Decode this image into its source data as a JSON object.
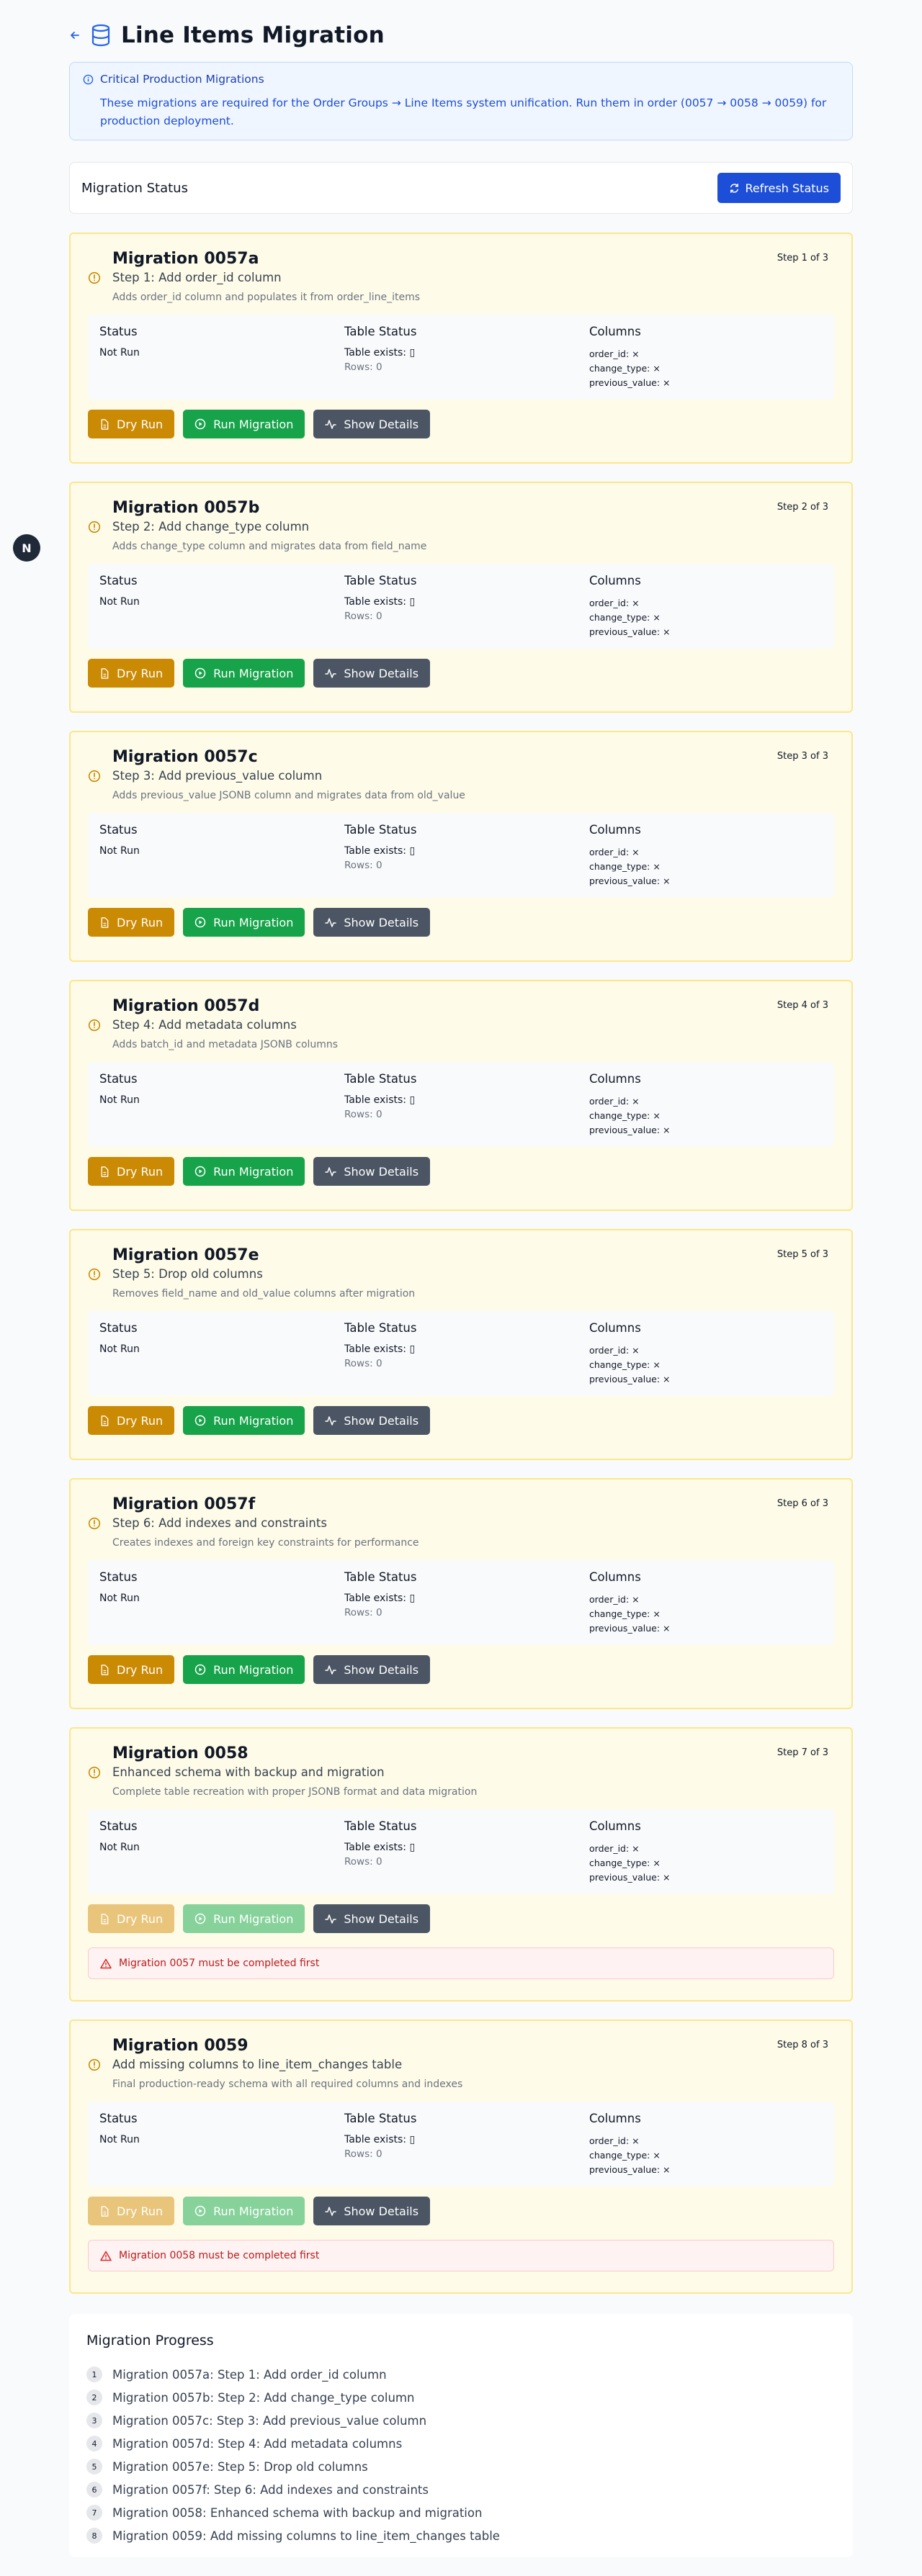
{
  "header": {
    "title": "Line Items Migration"
  },
  "info": {
    "title": "Critical Production Migrations",
    "text": "These migrations are required for the Order Groups → Line Items system unification. Run them in order (0057 → 0058 → 0059) for production deployment."
  },
  "status_bar": {
    "title": "Migration Status",
    "refresh_label": "Refresh Status"
  },
  "labels": {
    "status": "Status",
    "table_status": "Table Status",
    "columns": "Columns",
    "dry_run": "Dry Run",
    "run_migration": "Run Migration",
    "show_details": "Show Details"
  },
  "migrations": [
    {
      "title": "Migration 0057a",
      "subtitle": "Step 1: Add order_id column",
      "description": "Adds order_id column and populates it from order_line_items",
      "step": "Step 1 of 3",
      "status": "Not Run",
      "table_exists": "Table exists: ▯",
      "rows": "Rows: 0",
      "col1": "order_id: ×",
      "col2": "change_type: ×",
      "col3": "previous_value: ×"
    },
    {
      "title": "Migration 0057b",
      "subtitle": "Step 2: Add change_type column",
      "description": "Adds change_type column and migrates data from field_name",
      "step": "Step 2 of 3",
      "status": "Not Run",
      "table_exists": "Table exists: ▯",
      "rows": "Rows: 0",
      "col1": "order_id: ×",
      "col2": "change_type: ×",
      "col3": "previous_value: ×"
    },
    {
      "title": "Migration 0057c",
      "subtitle": "Step 3: Add previous_value column",
      "description": "Adds previous_value JSONB column and migrates data from old_value",
      "step": "Step 3 of 3",
      "status": "Not Run",
      "table_exists": "Table exists: ▯",
      "rows": "Rows: 0",
      "col1": "order_id: ×",
      "col2": "change_type: ×",
      "col3": "previous_value: ×"
    },
    {
      "title": "Migration 0057d",
      "subtitle": "Step 4: Add metadata columns",
      "description": "Adds batch_id and metadata JSONB columns",
      "step": "Step 4 of 3",
      "status": "Not Run",
      "table_exists": "Table exists: ▯",
      "rows": "Rows: 0",
      "col1": "order_id: ×",
      "col2": "change_type: ×",
      "col3": "previous_value: ×"
    },
    {
      "title": "Migration 0057e",
      "subtitle": "Step 5: Drop old columns",
      "description": "Removes field_name and old_value columns after migration",
      "step": "Step 5 of 3",
      "status": "Not Run",
      "table_exists": "Table exists: ▯",
      "rows": "Rows: 0",
      "col1": "order_id: ×",
      "col2": "change_type: ×",
      "col3": "previous_value: ×"
    },
    {
      "title": "Migration 0057f",
      "subtitle": "Step 6: Add indexes and constraints",
      "description": "Creates indexes and foreign key constraints for performance",
      "step": "Step 6 of 3",
      "status": "Not Run",
      "table_exists": "Table exists: ▯",
      "rows": "Rows: 0",
      "col1": "order_id: ×",
      "col2": "change_type: ×",
      "col3": "previous_value: ×"
    },
    {
      "title": "Migration 0058",
      "subtitle": "Enhanced schema with backup and migration",
      "description": "Complete table recreation with proper JSONB format and data migration",
      "step": "Step 7 of 3",
      "status": "Not Run",
      "table_exists": "Table exists: ▯",
      "rows": "Rows: 0",
      "col1": "order_id: ×",
      "col2": "change_type: ×",
      "col3": "previous_value: ×",
      "alert": "Migration 0057 must be completed first"
    },
    {
      "title": "Migration 0059",
      "subtitle": "Add missing columns to line_item_changes table",
      "description": "Final production-ready schema with all required columns and indexes",
      "step": "Step 8 of 3",
      "status": "Not Run",
      "table_exists": "Table exists: ▯",
      "rows": "Rows: 0",
      "col1": "order_id: ×",
      "col2": "change_type: ×",
      "col3": "previous_value: ×",
      "alert": "Migration 0058 must be completed first"
    }
  ],
  "progress": {
    "title": "Migration Progress",
    "items": [
      {
        "num": "1",
        "label": "Migration 0057a: Step 1: Add order_id column"
      },
      {
        "num": "2",
        "label": "Migration 0057b: Step 2: Add change_type column"
      },
      {
        "num": "3",
        "label": "Migration 0057c: Step 3: Add previous_value column"
      },
      {
        "num": "4",
        "label": "Migration 0057d: Step 4: Add metadata columns"
      },
      {
        "num": "5",
        "label": "Migration 0057e: Step 5: Drop old columns"
      },
      {
        "num": "6",
        "label": "Migration 0057f: Step 6: Add indexes and constraints"
      },
      {
        "num": "7",
        "label": "Migration 0058: Enhanced schema with backup and migration"
      },
      {
        "num": "8",
        "label": "Migration 0059: Add missing columns to line_item_changes table"
      }
    ]
  },
  "floating_button": {
    "label": "N"
  },
  "colors": {
    "primary": "#1d4ed8",
    "warning_bg": "#fefce8",
    "warning_border": "#fde68a",
    "dry_run": "#ca8a04",
    "run": "#16a34a",
    "details": "#4b5563",
    "danger": "#b91c1c"
  },
  "icons": {
    "back": "arrow-left-icon",
    "header": "database-icon",
    "info": "info-icon",
    "refresh": "refresh-icon",
    "warning": "clock-warning-icon",
    "dry_run": "file-icon",
    "run": "play-circle-icon",
    "details": "activity-icon",
    "alert": "alert-triangle-icon"
  }
}
